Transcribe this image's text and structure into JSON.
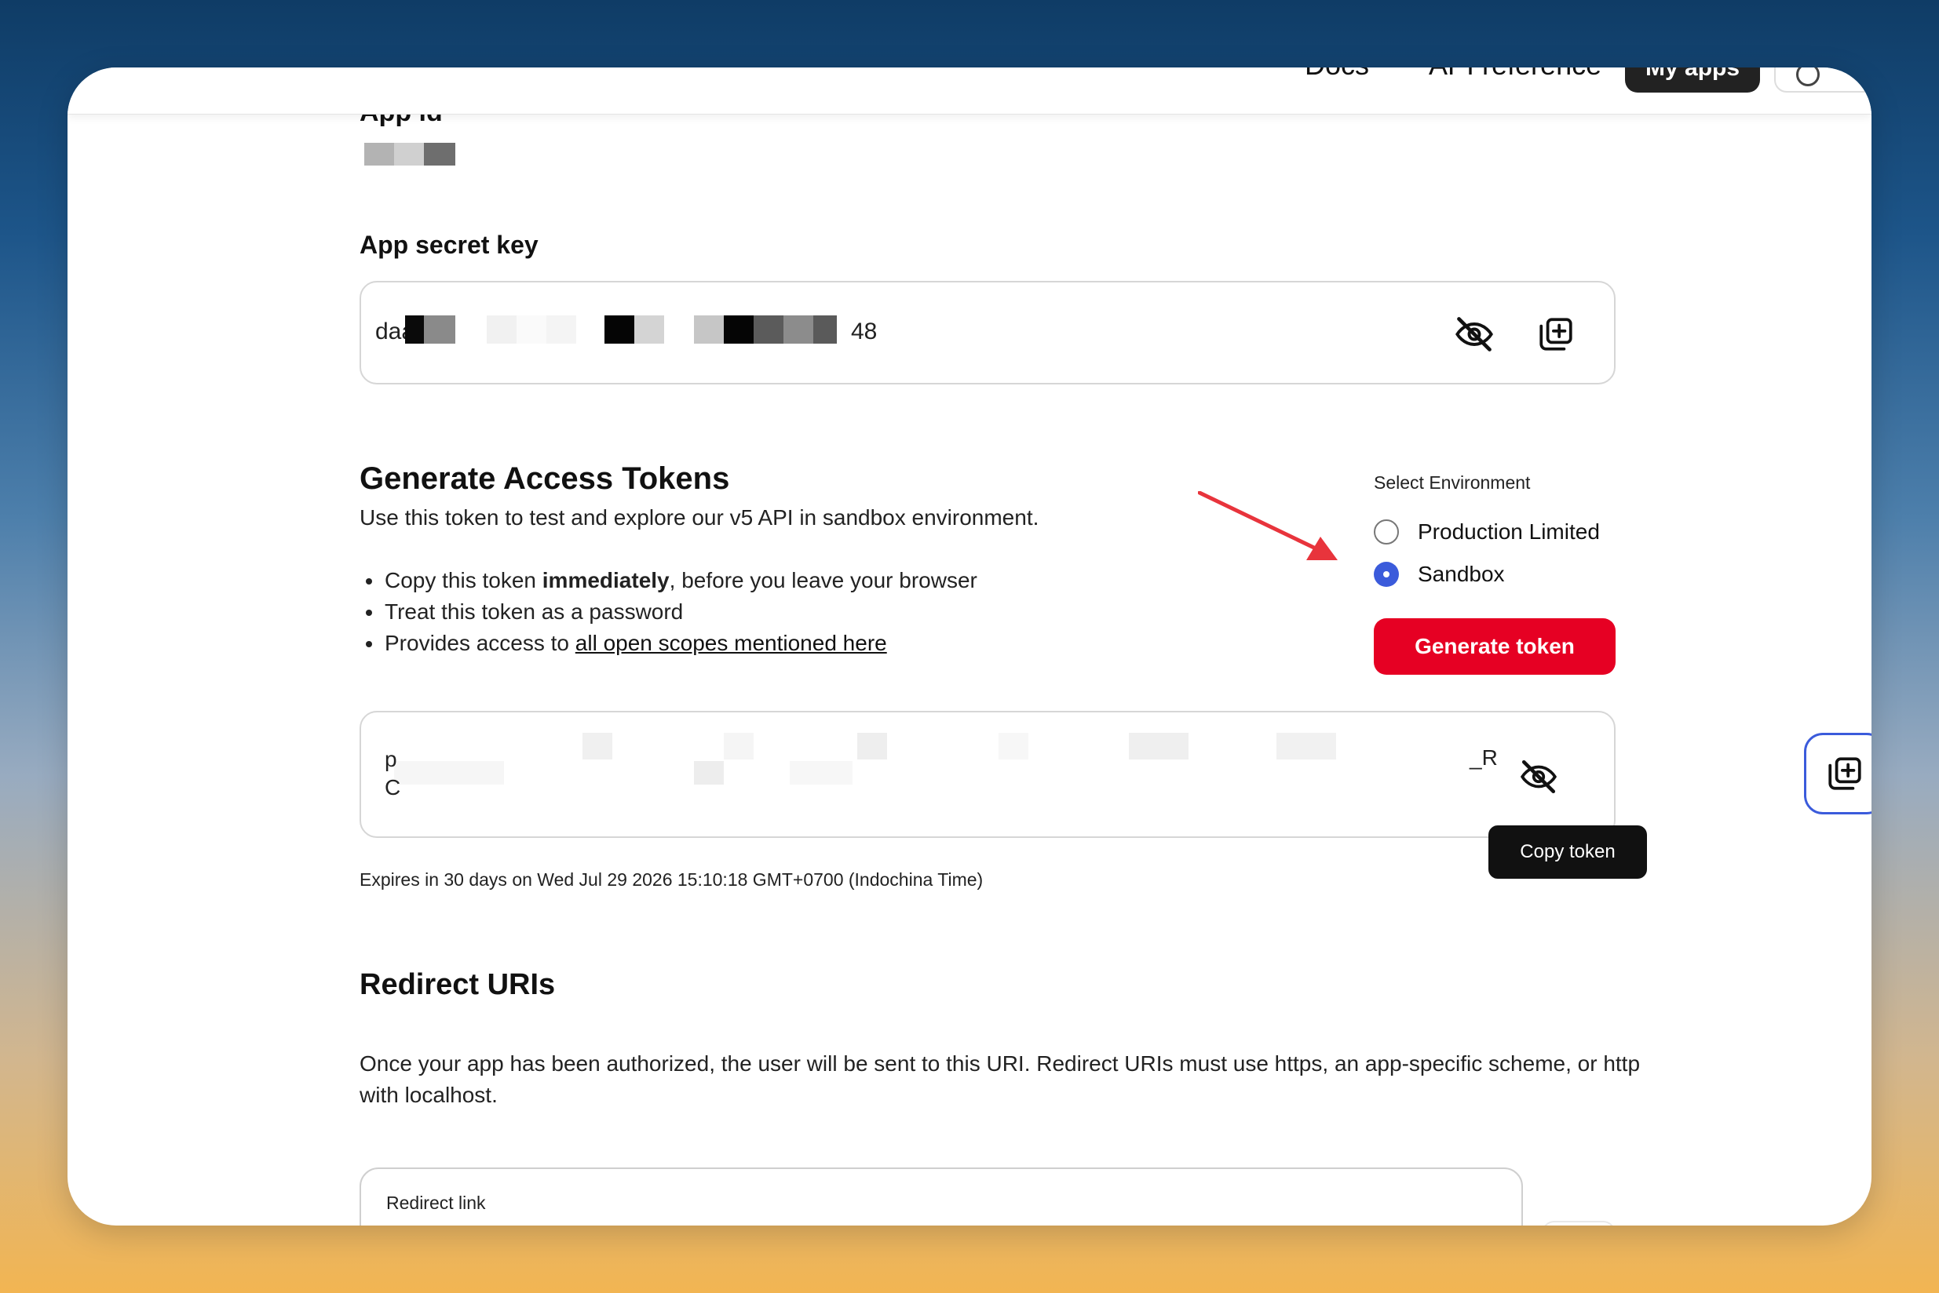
{
  "nav": {
    "docs": "Docs",
    "api_reference": "API reference",
    "my_apps": "My apps"
  },
  "app_id": {
    "label": "App id"
  },
  "secret_key": {
    "label": "App secret key",
    "prefix": "daa",
    "suffix": "48",
    "toggle_icon": "eye-off-icon",
    "copy_icon": "copy-plus-icon"
  },
  "tokens": {
    "heading": "Generate Access Tokens",
    "description": "Use this token to test and explore our v5 API in sandbox environment.",
    "bullets": {
      "b1_pre": "Copy this token ",
      "b1_bold": "immediately",
      "b1_post": ", before you leave your browser",
      "b2": "Treat this token as a password",
      "b3_pre": "Provides access to ",
      "b3_link": "all open scopes mentioned here"
    },
    "environment": {
      "label": "Select Environment",
      "options": [
        "Production Limited",
        "Sandbox"
      ],
      "selected": "Sandbox"
    },
    "generate_label": "Generate token",
    "token_start_line1": "p",
    "token_start_line2": "C",
    "token_end": "_R",
    "copy_tooltip": "Copy token",
    "expires": "Expires in 30 days on Wed Jul 29 2026 15:10:18 GMT+0700 (Indochina Time)"
  },
  "redirect": {
    "heading": "Redirect URIs",
    "description": "Once your app has been authorized, the user will be sent to this URI. Redirect URIs must use https, an app-specific scheme, or http with localhost.",
    "field_label": "Redirect link"
  },
  "colors": {
    "accent_red": "#e60023",
    "radio_blue": "#3b5bdb",
    "arrow_red": "#e8343c"
  }
}
